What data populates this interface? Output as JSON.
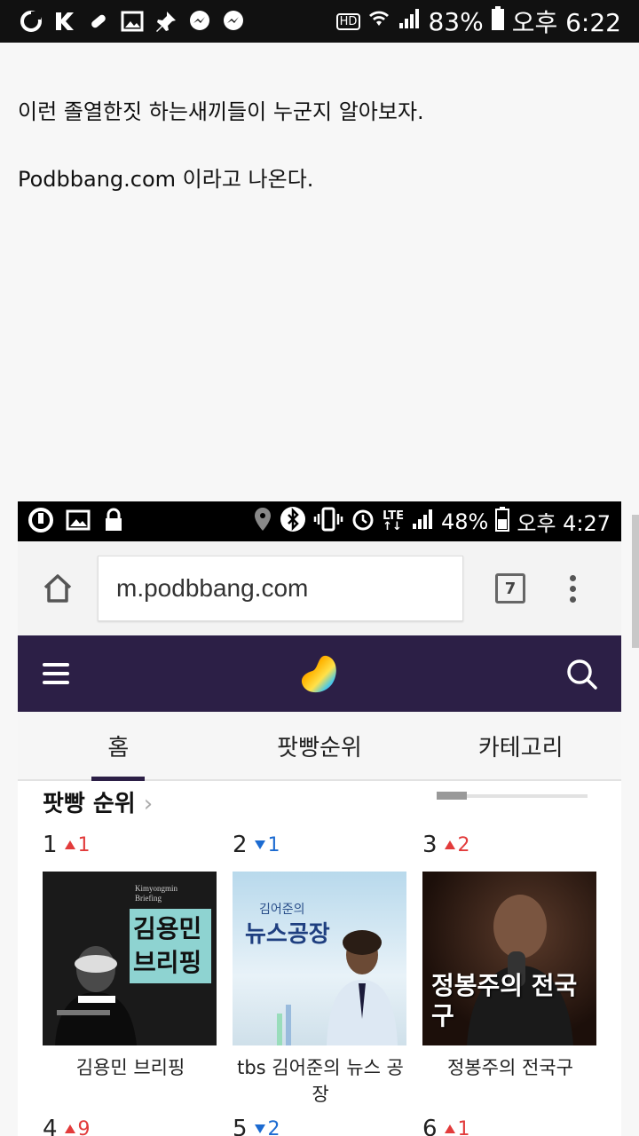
{
  "status_bar": {
    "battery": "83%",
    "time": "오후 6:22",
    "hd": "HD"
  },
  "post": {
    "line1": "이런 졸열한짓 하는새끼들이 누군지 알아보자.",
    "line2": "Podbbang.com  이라고 나온다."
  },
  "embedded": {
    "status_bar": {
      "battery": "48%",
      "time": "오후 4:27"
    },
    "browser": {
      "url": "m.podbbang.com",
      "tab_count": "7"
    },
    "tabs": [
      "홈",
      "팟빵순위",
      "카테고리"
    ],
    "rank_header": "팟빵 순위",
    "rank_items": [
      {
        "rank": "1",
        "change": "1",
        "dir": "up",
        "title": "김용민 브리핑",
        "thumb_text": "김용민\n브리핑",
        "thumb_sub": "Kimyongmin Briefing"
      },
      {
        "rank": "2",
        "change": "1",
        "dir": "down",
        "title": "tbs 김어준의 뉴스 공장",
        "thumb_text": "뉴스공장",
        "thumb_sub": "김어준의"
      },
      {
        "rank": "3",
        "change": "2",
        "dir": "up",
        "title": "정봉주의 전국구",
        "thumb_text": "정봉주의 전국구",
        "thumb_sub": ""
      },
      {
        "rank": "4",
        "change": "9",
        "dir": "up",
        "title": ""
      },
      {
        "rank": "5",
        "change": "2",
        "dir": "down",
        "title": ""
      },
      {
        "rank": "6",
        "change": "1",
        "dir": "up",
        "title": ""
      }
    ]
  }
}
